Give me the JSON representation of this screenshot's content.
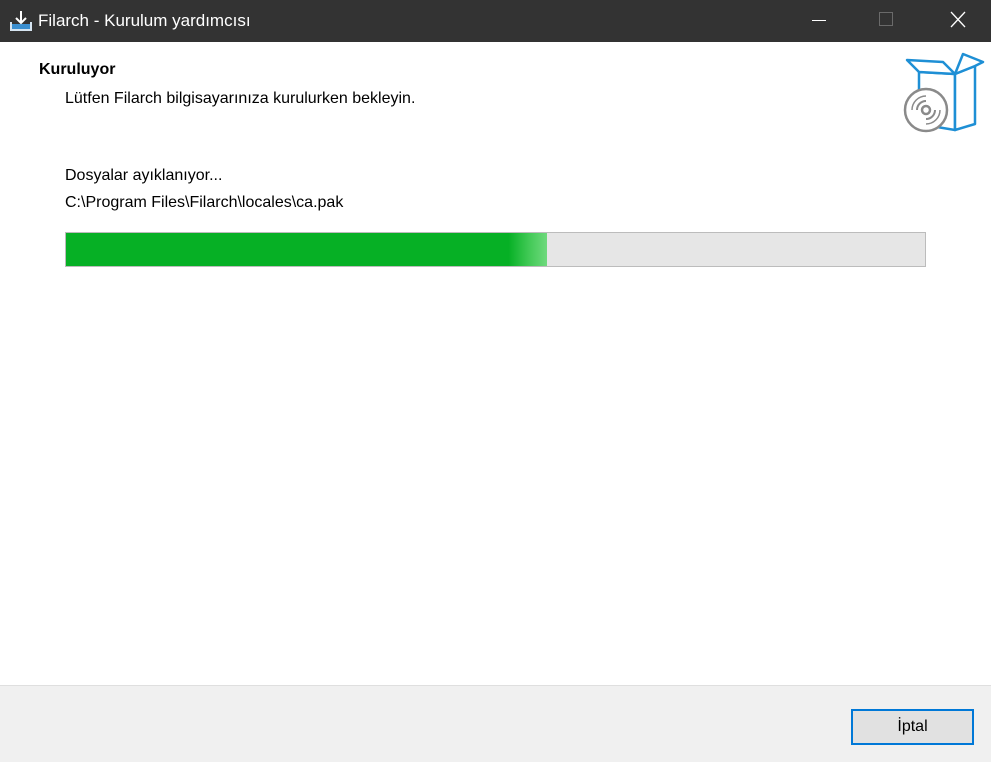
{
  "window": {
    "title": "Filarch - Kurulum yardımcısı",
    "app_icon": "installer-download-icon",
    "controls": [
      "minimize-icon",
      "maximize-icon",
      "close-icon"
    ]
  },
  "header": {
    "title": "Kuruluyor",
    "subtitle": "Lütfen Filarch bilgisayarınıza kurulurken bekleyin.",
    "icon": "software-box-disc-icon"
  },
  "progress": {
    "status": "Dosyalar ayıklanıyor...",
    "current_file": "C:\\Program Files\\Filarch\\locales\\ca.pak",
    "percent": 56
  },
  "footer": {
    "cancel_label": "İptal"
  },
  "colors": {
    "titlebar": "#333333",
    "progress_fill": "#06b025",
    "progress_track": "#e6e6e6",
    "accent": "#0078d7",
    "icon_blue": "#1e8fd5",
    "icon_gray": "#8a8a8a"
  }
}
